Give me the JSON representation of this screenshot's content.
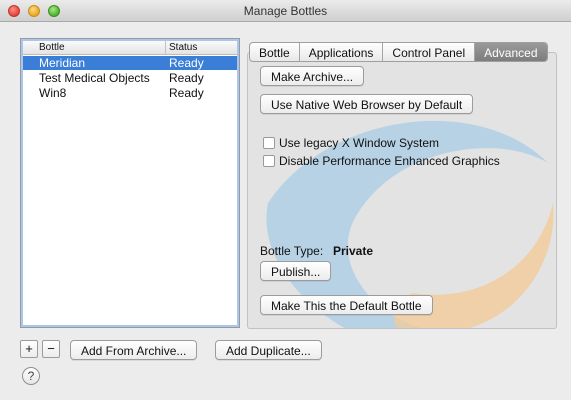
{
  "window": {
    "title": "Manage Bottles"
  },
  "bottle_list": {
    "columns": [
      "Bottle",
      "Status"
    ],
    "rows": [
      {
        "name": "Meridian",
        "status": "Ready",
        "selected": true
      },
      {
        "name": "Test Medical Objects",
        "status": "Ready",
        "selected": false
      },
      {
        "name": "Win8",
        "status": "Ready",
        "selected": false
      }
    ]
  },
  "tabs": [
    {
      "label": "Bottle",
      "active": false
    },
    {
      "label": "Applications",
      "active": false
    },
    {
      "label": "Control Panel",
      "active": false
    },
    {
      "label": "Advanced",
      "active": true
    }
  ],
  "advanced": {
    "make_archive_label": "Make Archive...",
    "native_browser_label": "Use Native Web Browser by Default",
    "legacy_x_label": "Use legacy X Window System",
    "legacy_x_checked": false,
    "disable_graphics_label": "Disable Performance Enhanced Graphics",
    "disable_graphics_checked": false,
    "bottle_type_label": "Bottle Type:",
    "bottle_type_value": "Private",
    "publish_label": "Publish...",
    "default_bottle_label": "Make This the Default Bottle"
  },
  "bottom": {
    "add_label": "+",
    "remove_label": "−",
    "add_from_archive_label": "Add From Archive...",
    "add_duplicate_label": "Add Duplicate...",
    "help_label": "?"
  },
  "colors": {
    "selection": "#3b7ed8",
    "accent_swoosh_blue": "#9fc4e0",
    "accent_swoosh_orange": "#f2c48f"
  }
}
